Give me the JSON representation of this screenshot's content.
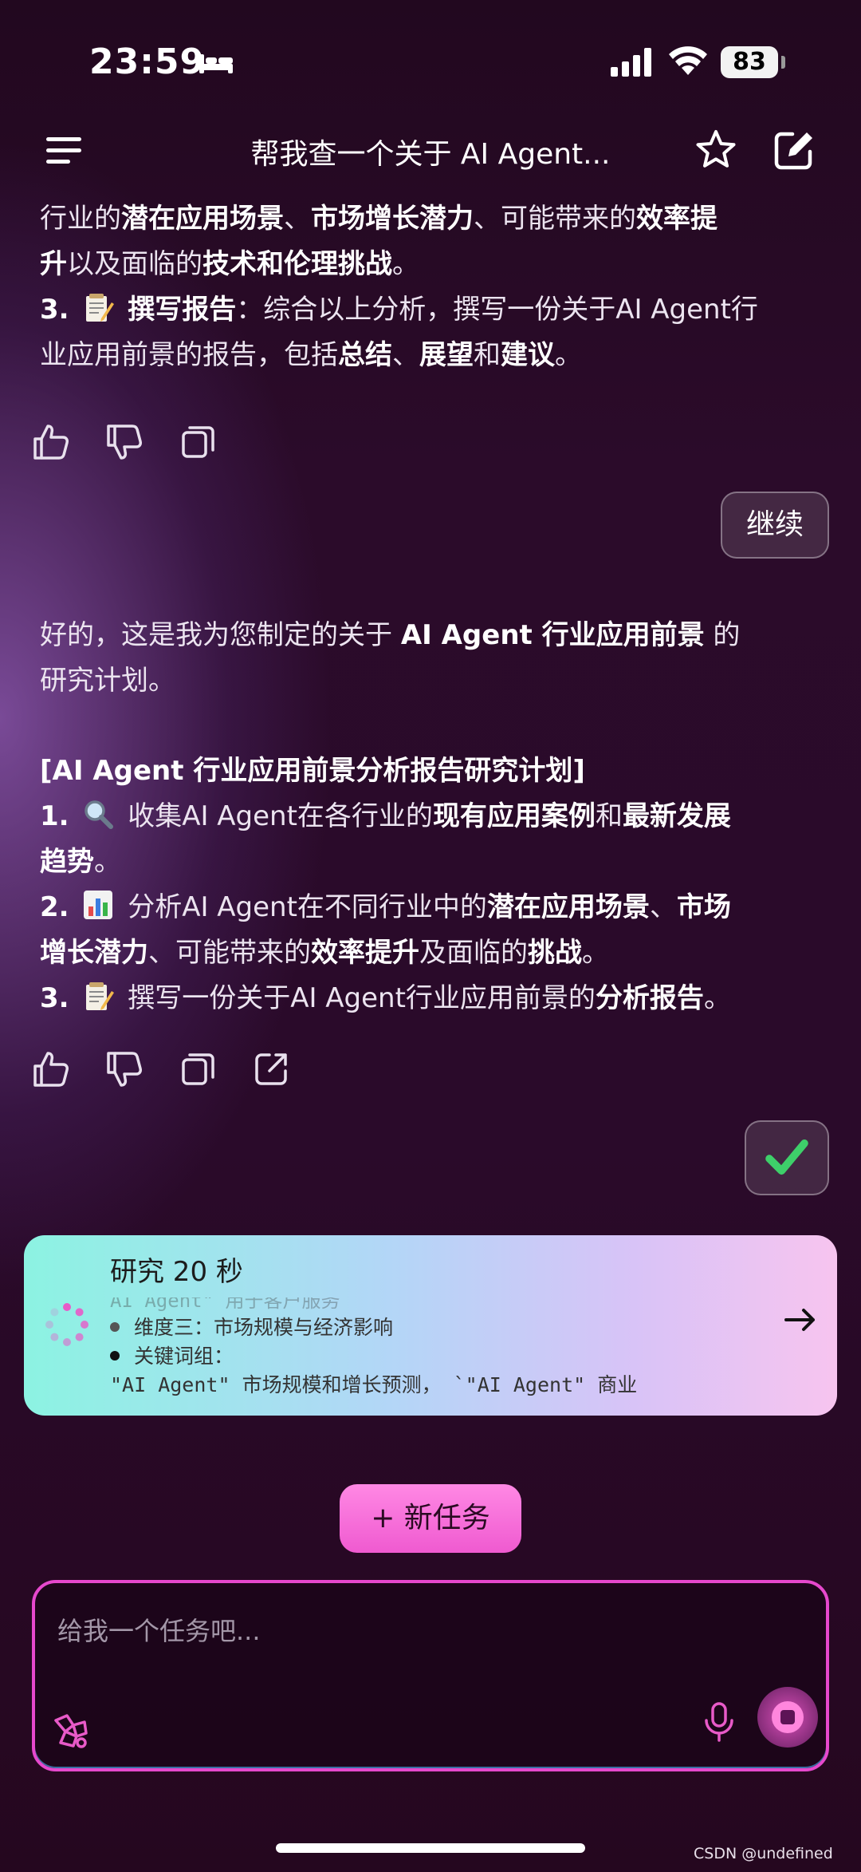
{
  "status_bar": {
    "time": "23:59",
    "battery": "83"
  },
  "header": {
    "title": "帮我查一个关于 AI Agent..."
  },
  "message1": {
    "l1_a": "行业的",
    "l1_b": "潜在应用场景",
    "l1_c": "、",
    "l1_d": "市场增长潜力",
    "l1_e": "、可能带来的",
    "l1_f": "效率提",
    "l2_a": "升",
    "l2_b": "以及面临的",
    "l2_c": "技术和伦理挑战",
    "l2_d": "。",
    "l3_a": "3.",
    "l3_b": "撰写报告",
    "l3_c": "：综合以上分析，撰写一份关于AI Agent行",
    "l4_a": "业应用前景的报告，包括",
    "l4_b": "总结",
    "l4_c": "、",
    "l4_d": "展望",
    "l4_e": "和",
    "l4_f": "建议",
    "l4_g": "。"
  },
  "continue_label": "继续",
  "message2": {
    "intro_a": "好的，这是我为您制定的关于 ",
    "intro_b": "AI Agent 行业应用前景",
    "intro_c": " 的",
    "intro_d": "研究计划。",
    "plan_title": "[AI Agent 行业应用前景分析报告研究计划]",
    "s1_a": "1.",
    "s1_b": " 收集AI Agent在各行业的",
    "s1_c": "现有应用案例",
    "s1_d": "和",
    "s1_e": "最新发展",
    "s1_f": "趋势",
    "s1_g": "。",
    "s2_a": "2.",
    "s2_b": " 分析AI Agent在不同行业中的",
    "s2_c": "潜在应用场景",
    "s2_d": "、",
    "s2_e": "市场",
    "s2_f": "增长潜力",
    "s2_g": "、可能带来的",
    "s2_h": "效率提升",
    "s2_i": "及面临的",
    "s2_j": "挑战",
    "s2_k": "。",
    "s3_a": "3.",
    "s3_b": " 撰写一份关于AI Agent行业应用前景的",
    "s3_c": "分析报告",
    "s3_d": "。"
  },
  "research_card": {
    "title": "研究 20 秒",
    "faded_line": "AI Agent\" 用于客户服务",
    "line1": "维度三：市场规模与经济影响",
    "line2": "关键词组：",
    "line3": "\"AI Agent\" 市场规模和增长预测， `\"AI Agent\" 商业"
  },
  "new_task_label": "+ 新任务",
  "input": {
    "placeholder": "给我一个任务吧..."
  },
  "watermark": "CSDN @undefined",
  "colors": {
    "accent_pink": "#ef5ad0",
    "check_green": "#3ecf6a",
    "card_gradient_start": "#8cf3e2",
    "card_gradient_end": "#f7c4ef"
  }
}
